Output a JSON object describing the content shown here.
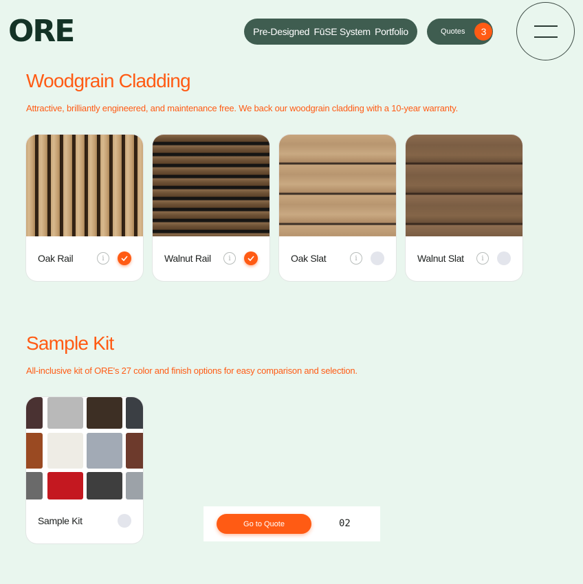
{
  "brand": {
    "logo_text": "ORE"
  },
  "nav": {
    "items": [
      "Pre-Designed",
      "FūSE System",
      "Portfolio"
    ],
    "quotes_label": "Quotes",
    "quotes_count": "3"
  },
  "woodgrain": {
    "title": "Woodgrain Cladding",
    "subtitle": "Attractive, brilliantly engineered, and maintenance free. We back our woodgrain cladding with a 10-year warranty.",
    "info_glyph": "i",
    "cards": [
      {
        "name": "Oak Rail",
        "selected": true
      },
      {
        "name": "Walnut Rail",
        "selected": true
      },
      {
        "name": "Oak Slat",
        "selected": false
      },
      {
        "name": "Walnut Slat",
        "selected": false
      }
    ]
  },
  "sample_kit": {
    "title": "Sample Kit",
    "subtitle": "All-inclusive kit of ORE's 27 color and finish options for easy comparison and selection.",
    "card_name": "Sample Kit",
    "selected": false,
    "swatch_colors": [
      "#4a3232",
      "#b9b9b9",
      "#3d2f24",
      "#3b3f44",
      "#9a4a22",
      "#eeece5",
      "#a2aab5",
      "#6d3a2c",
      "#6a6a6a",
      "#c41820",
      "#3e3e3e",
      "#9ca2a8"
    ]
  },
  "quote_bar": {
    "button_label": "Go to Quote",
    "count": "02"
  },
  "colors": {
    "accent": "#ff5b14",
    "nav_bg": "#3f5d50",
    "page_bg": "#e9f6ee"
  }
}
